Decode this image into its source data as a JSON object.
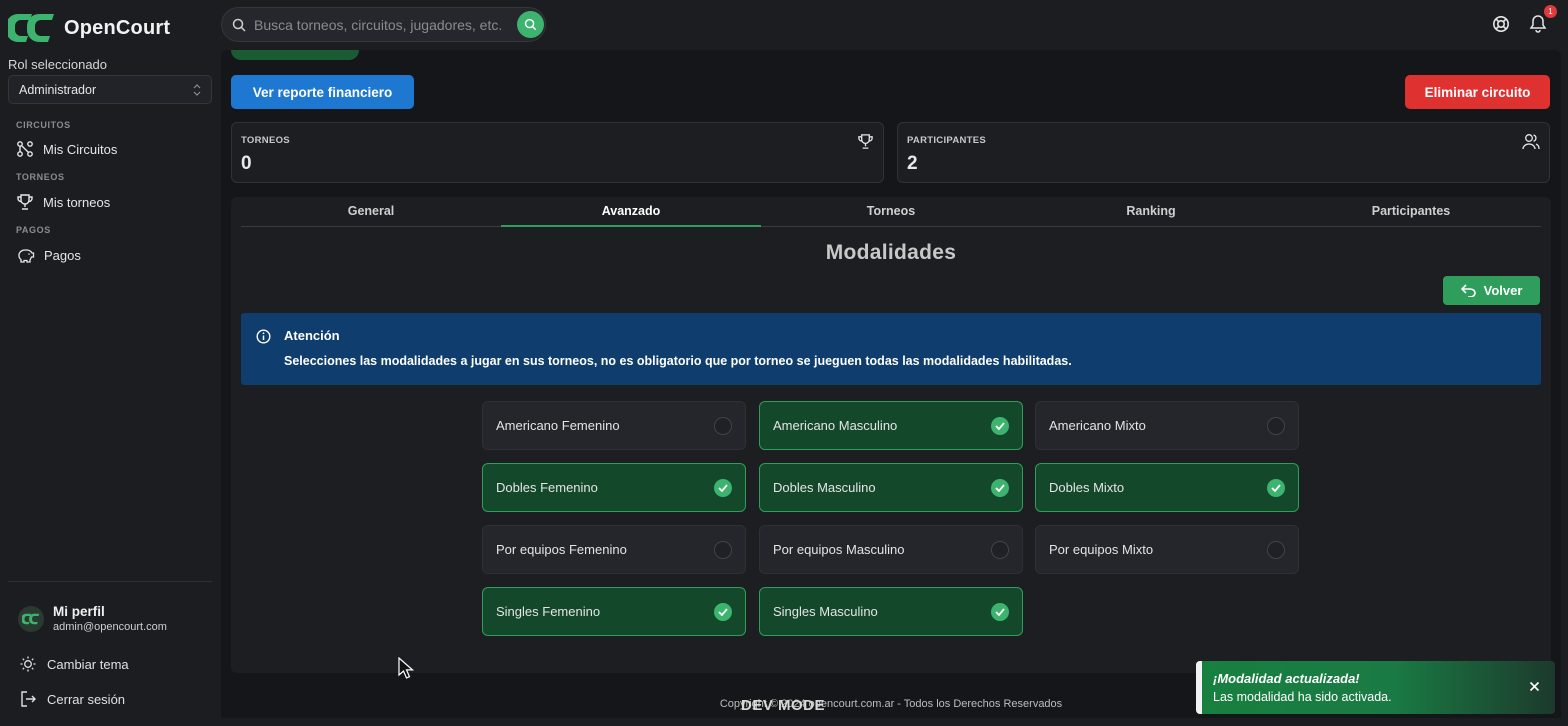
{
  "app": {
    "name": "OpenCourt"
  },
  "search": {
    "placeholder": "Busca torneos, circuitos, jugadores, etc."
  },
  "header": {
    "notifications_count": "1"
  },
  "sidebar": {
    "role_label": "Rol seleccionado",
    "role_value": "Administrador",
    "sections": [
      {
        "label": "CIRCUITOS",
        "item": "Mis Circuitos",
        "icon": "circuit-icon"
      },
      {
        "label": "TORNEOS",
        "item": "Mis torneos",
        "icon": "trophy-icon"
      },
      {
        "label": "PAGOS",
        "item": "Pagos",
        "icon": "piggy-bank-icon"
      }
    ],
    "profile_name": "Mi perfil",
    "profile_email": "admin@opencourt.com",
    "theme_label": "Cambiar tema",
    "logout_label": "Cerrar sesión"
  },
  "actions": {
    "report_label": "Ver reporte financiero",
    "delete_label": "Eliminar circuito"
  },
  "stats": [
    {
      "label": "TORNEOS",
      "value": "0",
      "icon": "trophy-icon"
    },
    {
      "label": "PARTICIPANTES",
      "value": "2",
      "icon": "users-icon"
    }
  ],
  "tabs": [
    "General",
    "Avanzado",
    "Torneos",
    "Ranking",
    "Participantes"
  ],
  "active_tab": "Avanzado",
  "section_title": "Modalidades",
  "back_label": "Volver",
  "alert": {
    "title": "Atención",
    "text": "Selecciones las modalidades a jugar en sus torneos, no es obligatorio que por torneo se jueguen todas las modalidades habilitadas."
  },
  "modalities": [
    {
      "label": "Americano Femenino",
      "enabled": false
    },
    {
      "label": "Americano Masculino",
      "enabled": true
    },
    {
      "label": "Americano Mixto",
      "enabled": false
    },
    {
      "label": "Dobles Femenino",
      "enabled": true
    },
    {
      "label": "Dobles Masculino",
      "enabled": true
    },
    {
      "label": "Dobles Mixto",
      "enabled": true
    },
    {
      "label": "Por equipos Femenino",
      "enabled": false
    },
    {
      "label": "Por equipos Masculino",
      "enabled": false
    },
    {
      "label": "Por equipos Mixto",
      "enabled": false
    },
    {
      "label": "Singles Femenino",
      "enabled": true
    },
    {
      "label": "Singles Masculino",
      "enabled": true
    }
  ],
  "footer": {
    "text": "Copyright © 2024 opencourt.com.ar - Todos los Derechos Reservados",
    "dev_mode": "DEV MODE"
  },
  "toast": {
    "title": "¡Modalidad actualizada!",
    "text": "Las modalidad ha sido activada."
  },
  "colors": {
    "accent_green": "#2f9e5c",
    "primary_blue": "#1e78d2",
    "danger_red": "#e03131",
    "alert_blue": "#0f3d6e"
  }
}
